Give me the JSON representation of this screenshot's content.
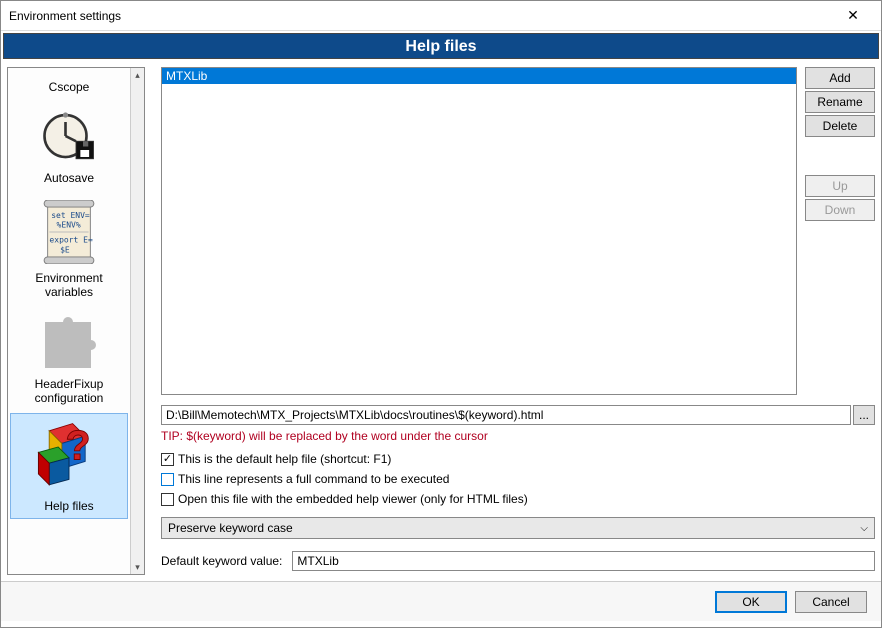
{
  "titlebar": {
    "text": "Environment settings",
    "close": "✕"
  },
  "banner": "Help files",
  "sidebar": {
    "items": [
      {
        "label": "Cscope"
      },
      {
        "label": "Autosave"
      },
      {
        "label": "Environment variables"
      },
      {
        "label": "HeaderFixup configuration"
      },
      {
        "label": "Help files"
      }
    ]
  },
  "list": {
    "items": [
      "MTXLib"
    ]
  },
  "buttons": {
    "add": "Add",
    "rename": "Rename",
    "delete": "Delete",
    "up": "Up",
    "down": "Down"
  },
  "path": "D:\\Bill\\Memotech\\MTX_Projects\\MTXLib\\docs\\routines\\$(keyword).html",
  "browse": "...",
  "tip": "TIP: $(keyword) will be replaced by the word under the cursor",
  "checks": {
    "default_help": "This is the default help file (shortcut: F1)",
    "full_command": "This line represents a full command to be executed",
    "embedded_viewer": "Open this file with the embedded help viewer (only for HTML files)"
  },
  "dropdown": {
    "selected": "Preserve keyword case"
  },
  "keyword": {
    "label": "Default keyword value:",
    "value": "MTXLib"
  },
  "footer": {
    "ok": "OK",
    "cancel": "Cancel"
  }
}
